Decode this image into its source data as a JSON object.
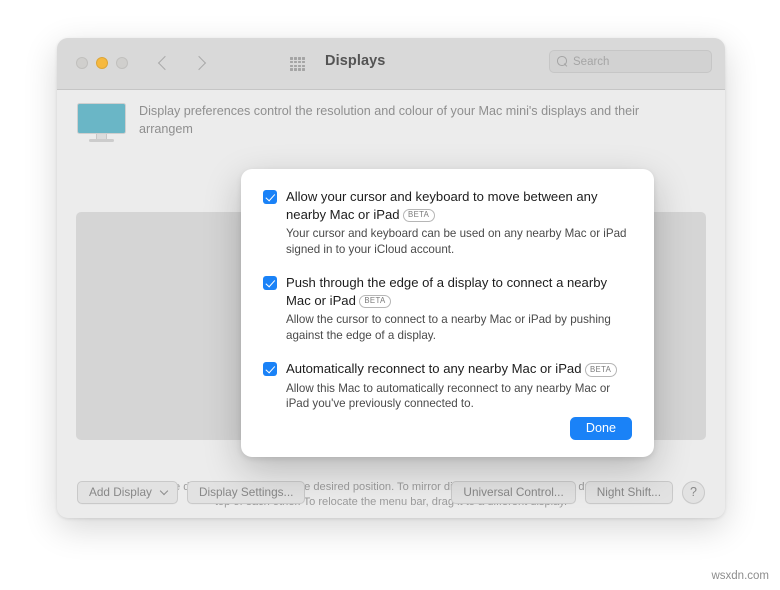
{
  "window": {
    "title": "Displays",
    "traffic_lights": [
      "close-light",
      "minimize-light",
      "zoom-light"
    ],
    "nav": {
      "back_icon": "chevron-left-icon",
      "forward_icon": "chevron-right-icon"
    },
    "grid_icon": "grid-apps-icon",
    "search": {
      "icon": "search-icon",
      "placeholder": "Search",
      "value": ""
    }
  },
  "main": {
    "monitor_icon": "display-monitor-icon",
    "monitor_color": "#6ab6c6",
    "intro_text": "Display preferences control the resolution and colour of your Mac mini's displays and their arrangem",
    "arrangement_hint": "To rearrange displays, drag them to the desired position. To mirror displays, hold Option while dragging them on top of each other. To relocate the menu bar, drag it to a different display."
  },
  "bottom_bar": {
    "add_display_label": "Add Display",
    "add_display_chevron": "chevron-down-icon",
    "display_settings_label": "Display Settings...",
    "universal_control_label": "Universal Control...",
    "night_shift_label": "Night Shift...",
    "help_label": "?"
  },
  "sheet": {
    "accent_color": "#1a82f7",
    "beta_badge": "BETA",
    "options": [
      {
        "checked": true,
        "title": "Allow your cursor and keyboard to move between any nearby Mac or iPad",
        "has_beta": true,
        "description": "Your cursor and keyboard can be used on any nearby Mac or iPad signed in to your iCloud account."
      },
      {
        "checked": true,
        "title": "Push through the edge of a display to connect a nearby Mac or iPad",
        "has_beta": true,
        "description": "Allow the cursor to connect to a nearby Mac or iPad by pushing against the edge of a display."
      },
      {
        "checked": true,
        "title": "Automatically reconnect to any nearby Mac or iPad",
        "has_beta": true,
        "description": "Allow this Mac to automatically reconnect to any nearby Mac or iPad you've previously connected to."
      }
    ],
    "done_label": "Done"
  },
  "watermark": "wsxdn.com"
}
